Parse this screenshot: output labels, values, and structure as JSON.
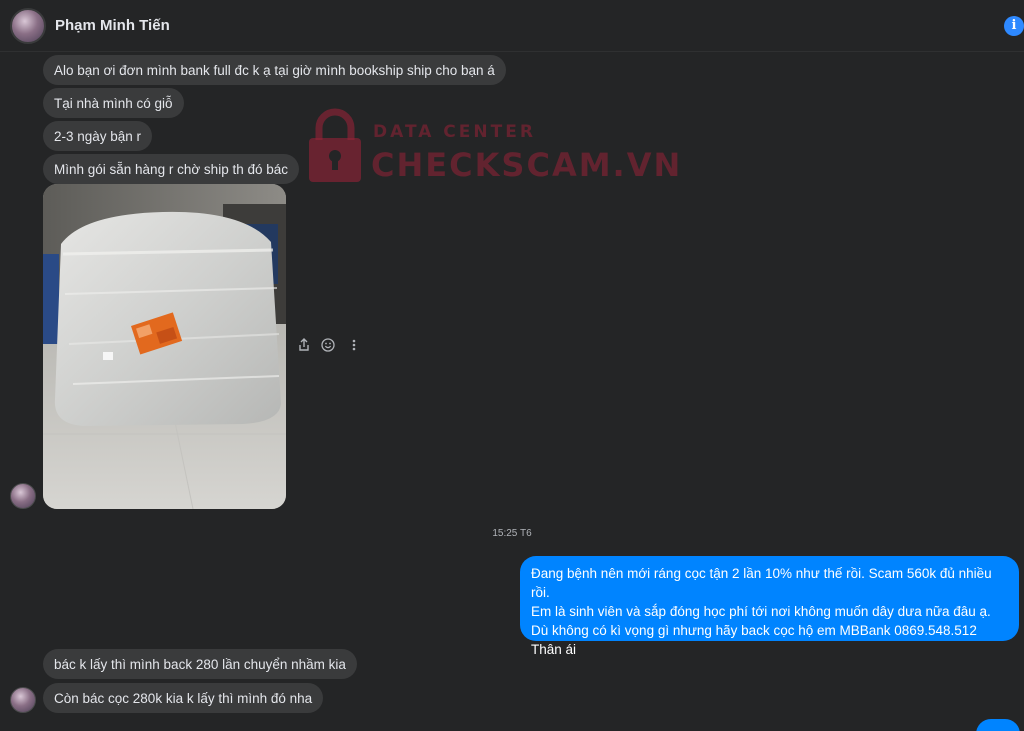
{
  "header": {
    "contact_name": "Phạm Minh Tiến",
    "info_icon": "info-icon"
  },
  "watermark": {
    "top_text": "DATA CENTER",
    "main_text": "CHECKSCAM.VN"
  },
  "messages_in_top": [
    "Alo bạn ơi đơn mình bank full đc k ạ tại giờ mình bookship ship cho bạn á",
    "Tại nhà mình có giỗ",
    "2-3 ngày bận r",
    "Mình gói sẵn hàng r chờ ship th đó bác"
  ],
  "timestamp": "15:25 T6",
  "message_out": {
    "lines": [
      "Đang bệnh nên mới ráng cọc tận 2 lần 10% như thế rồi. Scam 560k đủ nhiều rồi.",
      "Em là sinh viên và sắp đóng học phí tới nơi không muốn dây dưa nữa đâu ạ.",
      "Dù không có kì vọng gì nhưng hãy back cọc hộ em MBBank 0869.548.512",
      "Thân ái"
    ]
  },
  "messages_in_bottom": [
    "bác k lấy thì mình back 280 lần chuyển nhầm kia",
    "Còn bác cọc 280k kia k lấy thì mình đó nha"
  ],
  "colors": {
    "background": "#242526",
    "incoming_bubble": "#3a3b3c",
    "outgoing_bubble": "#0084ff",
    "accent": "#2e89ff"
  }
}
